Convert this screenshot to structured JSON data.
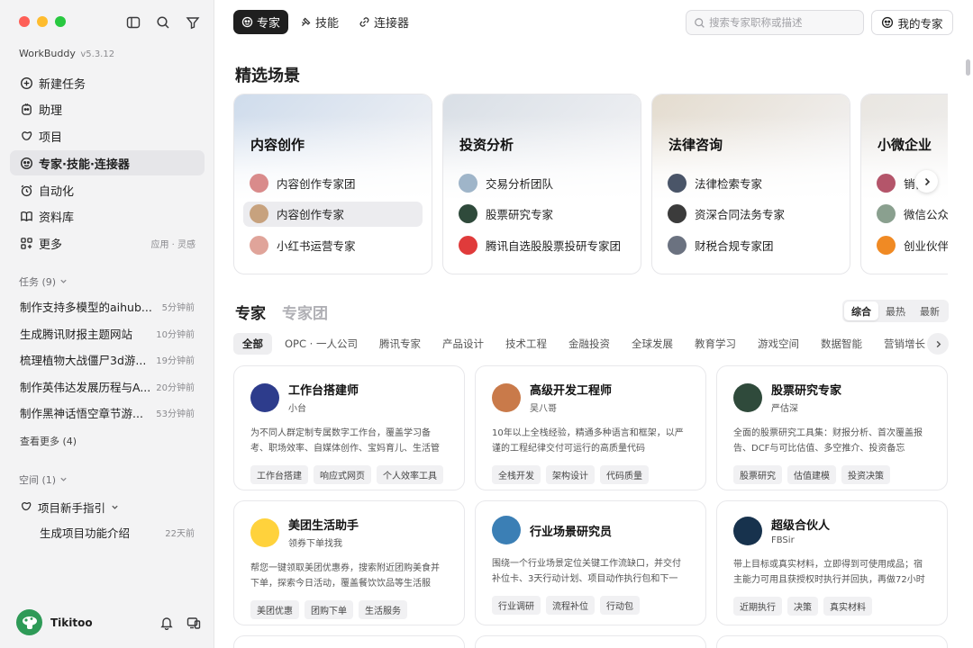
{
  "sidebar": {
    "app_name": "WorkBuddy",
    "version": "v5.3.12",
    "nav": [
      {
        "label": "新建任务",
        "icon": "plus-circle-icon"
      },
      {
        "label": "助理",
        "icon": "assistant-icon"
      },
      {
        "label": "项目",
        "icon": "project-icon"
      },
      {
        "label": "专家·技能·连接器",
        "icon": "expert-icon",
        "active": true
      },
      {
        "label": "自动化",
        "icon": "alarm-clock-icon"
      },
      {
        "label": "资料库",
        "icon": "book-icon"
      },
      {
        "label": "更多",
        "icon": "grid-plus-icon",
        "hint": "应用 · 灵感"
      }
    ],
    "tasks_title": "任务 (9)",
    "tasks": [
      {
        "name": "制作支持多模型的aihub...",
        "time": "5分钟前"
      },
      {
        "name": "生成腾讯财报主题网站",
        "time": "10分钟前"
      },
      {
        "name": "梳理植物大战僵尸3d游...",
        "time": "19分钟前"
      },
      {
        "name": "制作英伟达发展历程与A...",
        "time": "20分钟前"
      },
      {
        "name": "制作黑神话悟空章节游...",
        "time": "53分钟前"
      }
    ],
    "more_tasks": "查看更多 (4)",
    "spaces_title": "空间 (1)",
    "space_group": "项目新手指引",
    "space_item": {
      "name": "生成项目功能介绍",
      "time": "22天前"
    },
    "user_name": "Tikitoo"
  },
  "topbar": {
    "tabs": [
      {
        "label": "专家",
        "icon": "expert-icon",
        "active": true
      },
      {
        "label": "技能",
        "icon": "skill-icon"
      },
      {
        "label": "连接器",
        "icon": "link-icon"
      }
    ],
    "search_placeholder": "搜索专家职称或描述",
    "my_experts": "我的专家"
  },
  "featured": {
    "title": "精选场景",
    "scenes": [
      {
        "title": "内容创作",
        "bg": "#cfdcec",
        "items": [
          {
            "label": "内容创作专家团",
            "color": "#d98b8b"
          },
          {
            "label": "内容创作专家",
            "color": "#c7a27e",
            "selected": true
          },
          {
            "label": "小红书运营专家",
            "color": "#e0a49a"
          }
        ]
      },
      {
        "title": "投资分析",
        "bg": "#d9dfe6",
        "items": [
          {
            "label": "交易分析团队",
            "color": "#9fb5c9"
          },
          {
            "label": "股票研究专家",
            "color": "#2f4a3b"
          },
          {
            "label": "腾讯自选股股票投研专家团",
            "color": "#e03b3b"
          }
        ]
      },
      {
        "title": "法律咨询",
        "bg": "#e4dccf",
        "items": [
          {
            "label": "法律检索专家",
            "color": "#4a5568"
          },
          {
            "label": "资深合同法务专家",
            "color": "#3b3b3b"
          },
          {
            "label": "财税合规专家团",
            "color": "#6b7280"
          }
        ]
      },
      {
        "title": "小微企业",
        "bg": "#e9e6e1",
        "items": [
          {
            "label": "销售",
            "color": "#b4556a"
          },
          {
            "label": "微信公众号",
            "color": "#8aa08f"
          },
          {
            "label": "创业伙伴",
            "color": "#f08a24"
          }
        ]
      }
    ]
  },
  "experts": {
    "tabs": [
      "专家",
      "专家团"
    ],
    "sort": [
      "综合",
      "最热",
      "最新"
    ],
    "chips": [
      "全部",
      "OPC · 一人公司",
      "腾讯专家",
      "产品设计",
      "技术工程",
      "金融投资",
      "全球发展",
      "教育学习",
      "游戏空间",
      "数据智能",
      "营销增长"
    ],
    "cards": [
      {
        "name": "工作台搭建师",
        "author": "小台",
        "avatar_color": "#2d3c8c",
        "desc": "为不同人群定制专属数字工作台，覆盖学习备考、职场效率、自媒体创作、宝妈育儿、生活管理五...",
        "tags": [
          "工作台搭建",
          "响应式网页",
          "个人效率工具"
        ]
      },
      {
        "name": "高级开发工程师",
        "author": "吴八哥",
        "avatar_color": "#c97a4a",
        "desc": "10年以上全栈经验，精通多种语言和框架，以严谨的工程纪律交付可运行的高质量代码",
        "tags": [
          "全栈开发",
          "架构设计",
          "代码质量"
        ]
      },
      {
        "name": "股票研究专家",
        "author": "严估深",
        "avatar_color": "#2f4a3b",
        "desc": "全面的股票研究工具集：财报分析、首次覆盖报告、DCF与可比估值、多空推介、投资备忘录、...",
        "tags": [
          "股票研究",
          "估值建模",
          "投资决策"
        ]
      },
      {
        "name": "美团生活助手",
        "author": "领券下单找我",
        "avatar_color": "#ffd23c",
        "desc": "帮您一键领取美团优惠券，搜索附近团购美食并下单，探索今日活动，覆盖餐饮饮品等生活服务，...",
        "tags": [
          "美团优惠",
          "团购下单",
          "生活服务"
        ]
      },
      {
        "name": "行业场景研究员",
        "author": "",
        "avatar_color": "#3b7fb5",
        "desc": "围绕一个行业场景定位关键工作流缺口，并交付补位卡、3天行动计划、项目动作执行包和下一步...",
        "tags": [
          "行业调研",
          "流程补位",
          "行动包"
        ]
      },
      {
        "name": "超级合伙人",
        "author": "FBSir",
        "avatar_color": "#17324d",
        "desc": "带上目标或真实材料，立即得到可使用成品；宿主能力可用且获授权时执行并回执，再做72小时复...",
        "tags": [
          "近期执行",
          "决策",
          "真实材料"
        ]
      }
    ]
  }
}
